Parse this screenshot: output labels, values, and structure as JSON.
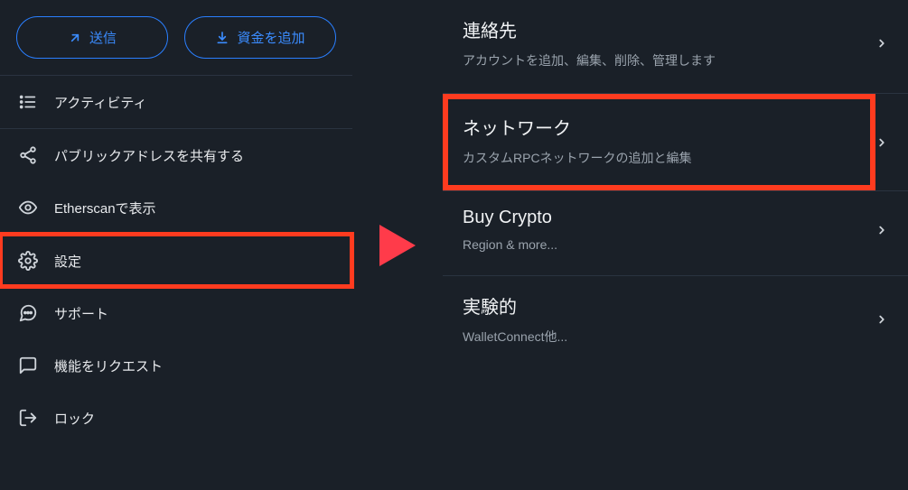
{
  "left": {
    "buttons": {
      "send": "送信",
      "add_funds": "資金を追加"
    },
    "menu": [
      {
        "label": "アクティビティ"
      },
      {
        "label": "パブリックアドレスを共有する"
      },
      {
        "label": "Etherscanで表示"
      },
      {
        "label": "設定"
      },
      {
        "label": "サポート"
      },
      {
        "label": "機能をリクエスト"
      },
      {
        "label": "ロック"
      }
    ]
  },
  "right": {
    "items": [
      {
        "title": "連絡先",
        "subtitle": "アカウントを追加、編集、削除、管理します"
      },
      {
        "title": "ネットワーク",
        "subtitle": "カスタムRPCネットワークの追加と編集"
      },
      {
        "title": "Buy Crypto",
        "subtitle": "Region & more..."
      },
      {
        "title": "実験的",
        "subtitle": "WalletConnect他..."
      }
    ]
  }
}
